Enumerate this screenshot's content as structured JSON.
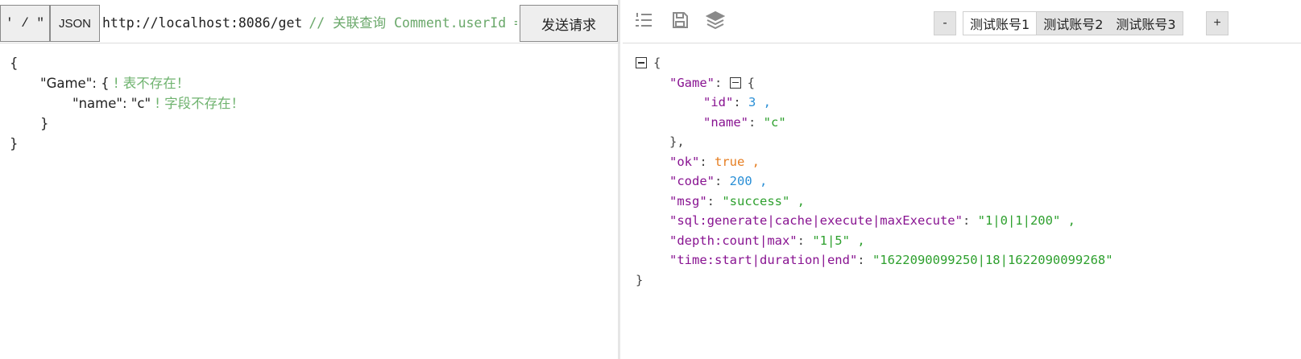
{
  "request": {
    "quote_button": "' / \"",
    "json_button": "JSON",
    "url": "http://localhost:8086/get",
    "url_comment": "// 关联查询 Comment.userId =",
    "send_button": "发送请求"
  },
  "left_code": {
    "open_brace": "{",
    "game_key": "\"Game\"",
    "game_sep": ": {",
    "game_warn": " ! 表不存在！",
    "name_key": "\"name\"",
    "name_sep": ": \"c\"",
    "name_warn": " ! 字段不存在！",
    "inner_close": "}",
    "outer_close": "}"
  },
  "toolbar": {
    "minus_label": "-",
    "plus_label": "+",
    "tabs": [
      "测试账号1",
      "测试账号2",
      "测试账号3"
    ]
  },
  "icons": {
    "list": "list-icon",
    "save": "save-icon",
    "layers": "layers-icon",
    "collapse": "collapse-icon"
  },
  "response": {
    "open": "{",
    "game_key": "\"Game\"",
    "game_open": "{",
    "id_key": "\"id\"",
    "id_val": "3",
    "name_key": "\"name\"",
    "name_val": "\"c\"",
    "game_close": "},",
    "ok_key": "\"ok\"",
    "ok_val": "true",
    "code_key": "\"code\"",
    "code_val": "200",
    "msg_key": "\"msg\"",
    "msg_val": "\"success\"",
    "sql_key": "\"sql:generate|cache|execute|maxExecute\"",
    "sql_val": "\"1|0|1|200\"",
    "depth_key": "\"depth:count|max\"",
    "depth_val": "\"1|5\"",
    "time_key": "\"time:start|duration|end\"",
    "time_val": "\"1622090099250|18|1622090099268\"",
    "close": "}"
  },
  "colors": {
    "key": "#881391",
    "string": "#2ea02e",
    "number": "#2a8fd6",
    "boolean": "#e67e22",
    "comment": "#6aa86a"
  }
}
